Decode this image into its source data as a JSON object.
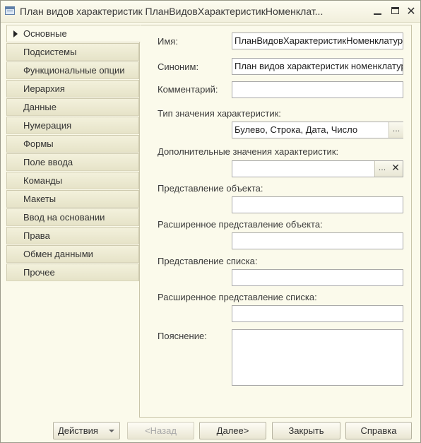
{
  "window": {
    "title": "План видов характеристик ПланВидовХарактеристикНоменклат..."
  },
  "sidebar": {
    "items": [
      {
        "label": "Основные"
      },
      {
        "label": "Подсистемы"
      },
      {
        "label": "Функциональные опции"
      },
      {
        "label": "Иерархия"
      },
      {
        "label": "Данные"
      },
      {
        "label": "Нумерация"
      },
      {
        "label": "Формы"
      },
      {
        "label": "Поле ввода"
      },
      {
        "label": "Команды"
      },
      {
        "label": "Макеты"
      },
      {
        "label": "Ввод на основании"
      },
      {
        "label": "Права"
      },
      {
        "label": "Обмен данными"
      },
      {
        "label": "Прочее"
      }
    ]
  },
  "form": {
    "name_label": "Имя:",
    "name_value": "ПланВидовХарактеристикНоменклатура",
    "synonym_label": "Синоним:",
    "synonym_value": "План видов характеристик номенклатуры",
    "comment_label": "Комментарий:",
    "comment_value": "",
    "type_label": "Тип значения характеристик:",
    "type_value": "Булево, Строка, Дата, Число",
    "type_select": "...",
    "addvalues_label": "Дополнительные значения характеристик:",
    "addvalues_value": "",
    "addvalues_select": "...",
    "addvalues_clear": "✕",
    "obj_repr_label": "Представление объекта:",
    "obj_repr_value": "",
    "ext_obj_repr_label": "Расширенное представление объекта:",
    "ext_obj_repr_value": "",
    "list_repr_label": "Представление списка:",
    "list_repr_value": "",
    "ext_list_repr_label": "Расширенное представление списка:",
    "ext_list_repr_value": "",
    "explanation_label": "Пояснение:",
    "explanation_value": ""
  },
  "footer": {
    "actions": "Действия",
    "back": "<Назад",
    "next": "Далее>",
    "close": "Закрыть",
    "help": "Справка"
  }
}
